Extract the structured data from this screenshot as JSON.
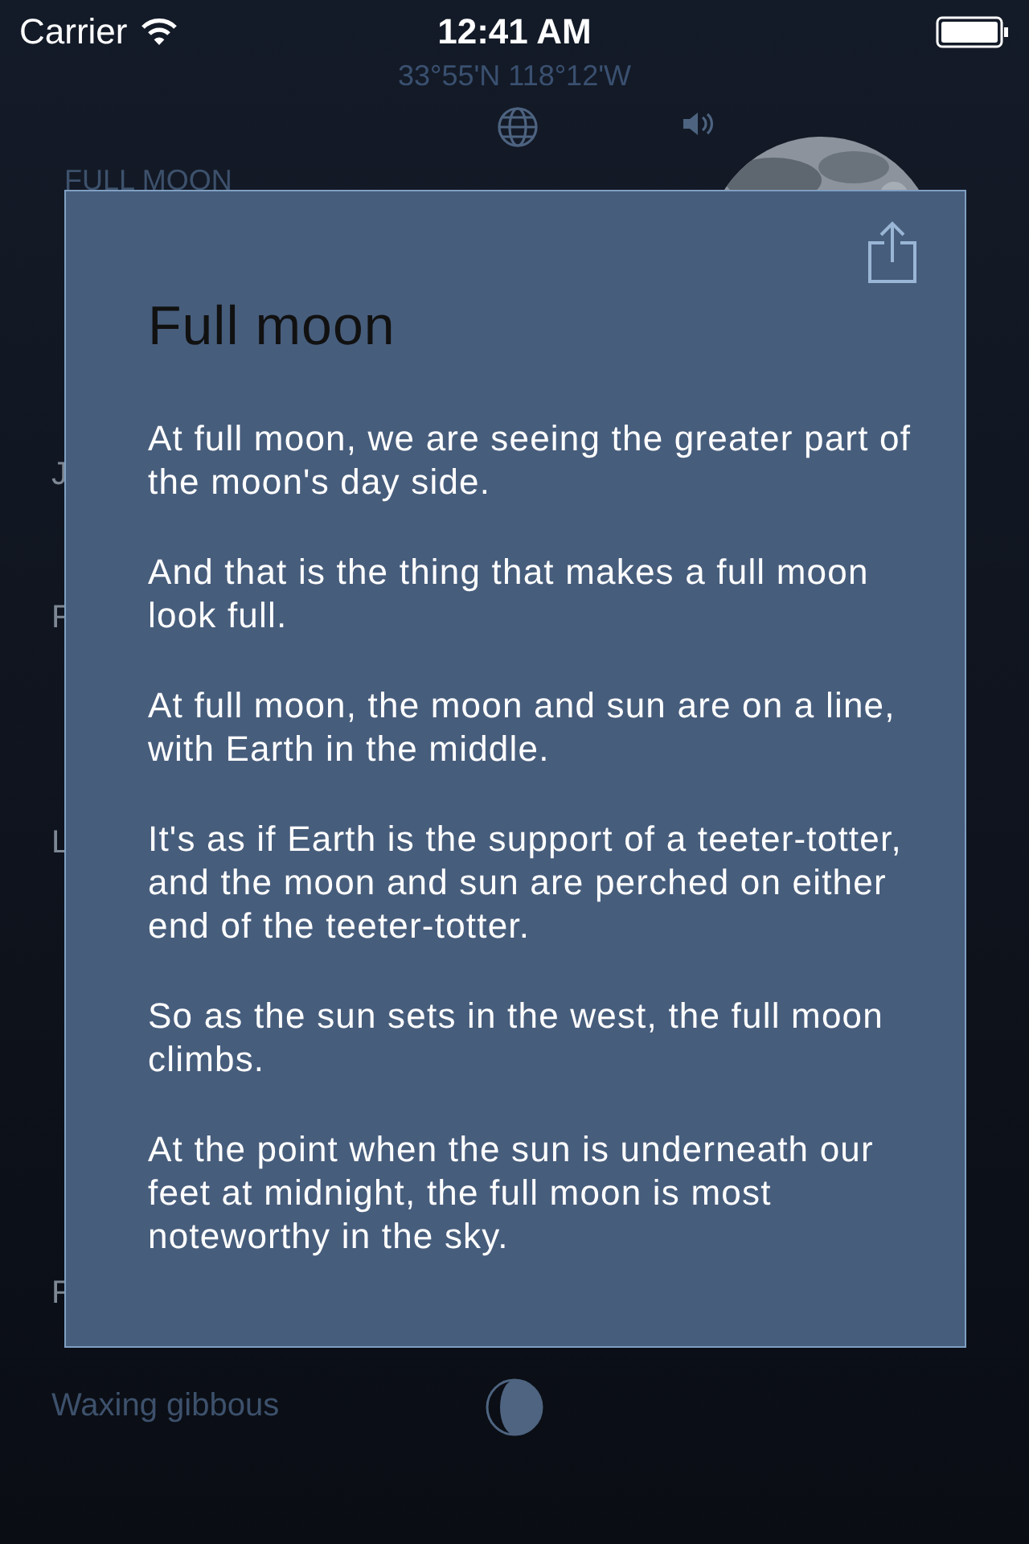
{
  "status_bar": {
    "carrier": "Carrier",
    "time": "12:41 AM"
  },
  "location": "33°55'N 118°12'W",
  "phase_heading": "FULL MOON",
  "background_rows": [
    {
      "label": "J"
    },
    {
      "label": "F"
    },
    {
      "label": "L"
    },
    {
      "label": "F"
    }
  ],
  "last_row": {
    "label": "Waxing gibbous"
  },
  "panel": {
    "title": "Full moon",
    "paragraphs": [
      "At full moon, we are seeing the greater part of the moon's day side.",
      "And that is the thing that makes a full moon look full.",
      "At full moon, the moon and sun are on a line, with Earth in the middle.",
      "It's as if Earth is the support of a teeter-totter, and the moon and sun are perched on either end of the teeter-totter.",
      "So as the sun sets in the west, the full moon climbs.",
      "At the point when the sun is underneath our feet at midnight, the full moon is most noteworthy in the sky."
    ]
  }
}
